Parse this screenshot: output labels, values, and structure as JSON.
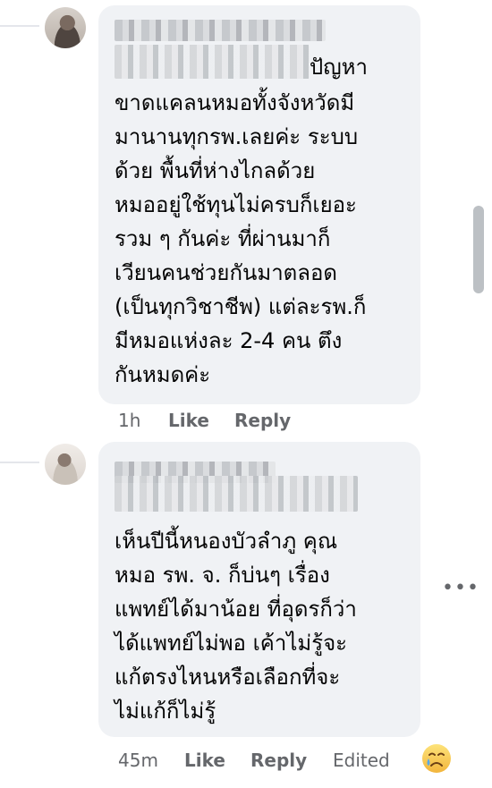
{
  "comments": [
    {
      "author": "",
      "text_first_line": "ปัญหา",
      "text_lines": [
        "ขาดแคลนหมอทั้งจังหวัดมี",
        "มานานทุกรพ.เลยค่ะ ระบบ",
        "ด้วย พื้นที่ห่างไกลด้วย",
        "หมออยู่ใช้ทุนไม่ครบก็เยอะ",
        "รวม ๆ กันค่ะ ที่ผ่านมาก็",
        "เวียนคนช่วยกันมาตลอด",
        "(เป็นทุกวิชาชีพ) แต่ละรพ.ก็",
        "มีหมอแห่งละ 2-4 คน ตึง",
        "กันหมดค่ะ"
      ],
      "time": "1h",
      "like_label": "Like",
      "reply_label": "Reply"
    },
    {
      "author": "",
      "text_lines": [
        "เห็นปีนี้หนองบัวลำภู คุณ",
        "หมอ รพ. จ. ก็บ่นๆ เรื่อง",
        "แพทย์ได้มาน้อย ที่อุดรก็ว่า",
        "ได้แพทย์ไม่พอ เค้าไม่รู้จะ",
        "แก้ตรงไหนหรือเลือกที่จะ",
        "ไม่แก้ก็ไม่รู้"
      ],
      "time": "45m",
      "like_label": "Like",
      "reply_label": "Reply",
      "edited_label": "Edited",
      "more_label": "•••",
      "reaction_icon": "crying-face-icon"
    }
  ]
}
